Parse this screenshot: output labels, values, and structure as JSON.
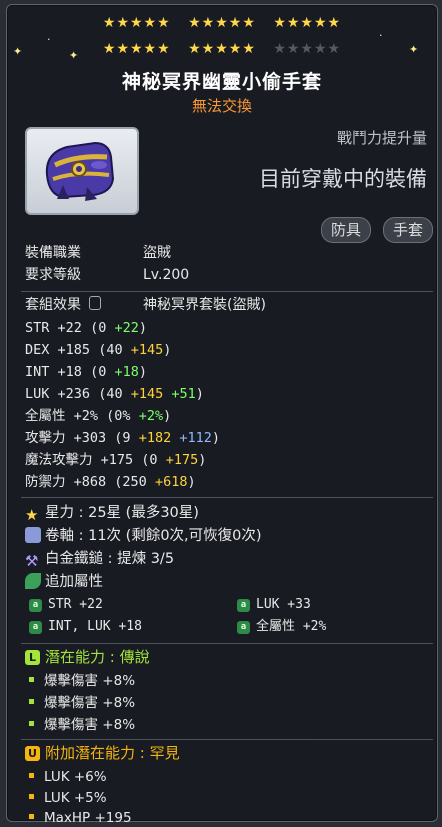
{
  "item": {
    "stars_row1": [
      "★★★★★",
      "★★★★★",
      "★★★★★"
    ],
    "stars_row2_on": [
      "★★★★★",
      "★★★★★"
    ],
    "stars_row2_off": "★★★★★",
    "name": "神秘冥界幽靈小偷手套",
    "trade": "無法交換",
    "power_label": "戰鬥力提升量",
    "wearing_label": "目前穿戴中的裝備",
    "tags": [
      "防具",
      "手套"
    ]
  },
  "requirements": {
    "job_label": "裝備職業",
    "job_value": "盜賊",
    "level_label": "要求等級",
    "level_value": "Lv.200"
  },
  "set": {
    "label": "套組效果",
    "value": "神秘冥界套裝(盜賊)"
  },
  "stats": [
    {
      "name": "STR",
      "total": "+22",
      "base": "(0",
      "parts": [
        {
          "v": "+22",
          "c": "green"
        }
      ]
    },
    {
      "name": "DEX",
      "total": "+185",
      "base": "(40",
      "parts": [
        {
          "v": "+145",
          "c": "yellow"
        }
      ]
    },
    {
      "name": "INT",
      "total": "+18",
      "base": "(0",
      "parts": [
        {
          "v": "+18",
          "c": "green"
        }
      ]
    },
    {
      "name": "LUK",
      "total": "+236",
      "base": "(40",
      "parts": [
        {
          "v": "+145",
          "c": "yellow"
        },
        {
          "v": "+51",
          "c": "green"
        }
      ]
    },
    {
      "name": "全屬性",
      "total": "+2%",
      "base": "(0%",
      "parts": [
        {
          "v": "+2%",
          "c": "green"
        }
      ]
    },
    {
      "name": "攻擊力",
      "total": "+303",
      "base": "(9",
      "parts": [
        {
          "v": "+182",
          "c": "yellow"
        },
        {
          "v": "+112",
          "c": "blue"
        }
      ]
    },
    {
      "name": "魔法攻擊力",
      "total": "+175",
      "base": "(0",
      "parts": [
        {
          "v": "+175",
          "c": "yellow"
        }
      ]
    },
    {
      "name": "防禦力",
      "total": "+868",
      "base": "(250",
      "parts": [
        {
          "v": "+618",
          "c": "yellow"
        }
      ]
    }
  ],
  "info": {
    "starforce": "星力 : 25星 (最多30星)",
    "scroll": "卷軸 : 11次 (剩餘0次,可恢復0次)",
    "hammer": "白金鐵鎚 : 提煉 3/5",
    "bonus_label": "追加屬性"
  },
  "bonus": [
    {
      "text": "STR  +22"
    },
    {
      "text": "LUK  +33"
    },
    {
      "text": "INT, LUK  +18"
    },
    {
      "text": "全屬性  +2%"
    }
  ],
  "bonus_badge": "a",
  "potential": {
    "badge": "L",
    "label": "潛在能力 : 傳說",
    "lines": [
      "爆擊傷害 +8%",
      "爆擊傷害 +8%",
      "爆擊傷害 +8%"
    ]
  },
  "additional": {
    "badge": "U",
    "label": "附加潛在能力 : 罕見",
    "lines": [
      "LUK +6%",
      "LUK +5%",
      "MaxHP +195"
    ]
  },
  "colors": {
    "legendary": "#a4e33b",
    "unique": "#f6b40f",
    "title": "#ffffff",
    "trade": "#ff9933"
  }
}
